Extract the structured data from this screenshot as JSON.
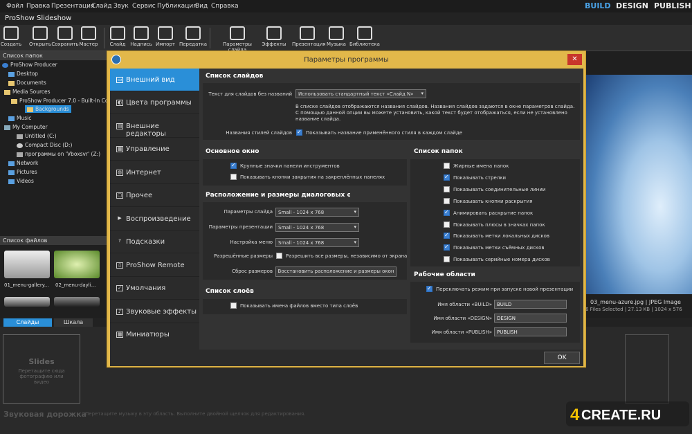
{
  "menubar": {
    "items": [
      "Файл",
      "Правка",
      "Презентация",
      "Слайд",
      "Звук",
      "Сервис",
      "Публикация",
      "Вид",
      "Справка"
    ],
    "modes": [
      "BUILD",
      "DESIGN",
      "PUBLISH"
    ]
  },
  "app": {
    "title": "ProShow Slideshow"
  },
  "toolbar": {
    "left": [
      "Создать",
      "Открыть",
      "Сохранить",
      "Мастер"
    ],
    "mid": [
      "Слайд",
      "Надпись",
      "Импорт",
      "Передатка"
    ],
    "right": [
      "Параметры слайда",
      "Эффекты",
      "Презентация",
      "Музыка",
      "Библиотека"
    ]
  },
  "folders": {
    "header": "Список папок",
    "items": [
      "ProShow Producer",
      "Desktop",
      "Documents",
      "Media Sources",
      "ProShow Producer 7.0 - Built-In Co",
      "Backgrounds",
      "Music",
      "My Computer",
      "Untitled (C:)",
      "Compact Disc (D:)",
      "программы on 'Vboxsvr' (Z:)",
      "Network",
      "Pictures",
      "Videos"
    ]
  },
  "files": {
    "header": "Список файлов",
    "thumbs": [
      "01_menu-gallery...",
      "02_menu-dayli..."
    ]
  },
  "preview": {
    "filename": "03_menu-azure.jpg",
    "type": "JPEG Image",
    "sel": "6 Files Selected",
    "size": "27.13 KB",
    "dims": "1024 x 576"
  },
  "timeline": {
    "tab_slides": "Слайды",
    "tab_scale": "Шкала",
    "slides_title": "Slides",
    "slides_hint": "Перетащите сюда фотографию или видео",
    "audio_label": "Звуковая дорожка",
    "audio_hint": "Перетащите музыку в эту область. Выполните двойной щелчок для редактирования."
  },
  "dialog": {
    "title": "Параметры программы",
    "close": "✕",
    "ok": "OK",
    "nav": [
      {
        "label": "Внешний вид",
        "icon": "▭"
      },
      {
        "label": "Цвета программы",
        "icon": "◐"
      },
      {
        "label": "Внешние редакторы",
        "icon": "▤"
      },
      {
        "label": "Управление",
        "icon": "▦"
      },
      {
        "label": "Интернет",
        "icon": "◍"
      },
      {
        "label": "Прочее",
        "icon": "▢"
      },
      {
        "label": "Воспроизведение",
        "icon": "▶"
      },
      {
        "label": "Подсказки",
        "icon": "?"
      },
      {
        "label": "ProShow Remote",
        "icon": "▯"
      },
      {
        "label": "Умолчания",
        "icon": "✓"
      },
      {
        "label": "Звуковые эффекты",
        "icon": "♪"
      },
      {
        "label": "Миниатюры",
        "icon": "▩"
      }
    ],
    "slides_list": {
      "title": "Список слайдов",
      "unnamed_label": "Текст для слайдов без названий",
      "unnamed_value": "Использовать стандартный текст «Слайд N»",
      "desc": "В списке слайдов отображаются названия слайдов. Названия слайдов задаются в окне параметров слайда. С помощью данной опции вы можете установить, какой текст будет отображаться, если не установлено название слайда.",
      "style_label": "Названия стилей слайдов",
      "style_check": "Показывать название применённого стиля в каждом слайде"
    },
    "main_window": {
      "title": "Основное окно",
      "opts": [
        "Крупные значки панели инструментов",
        "Показывать кнопки закрытия на закреплённых панелях"
      ]
    },
    "dialog_sizes": {
      "title": "Расположение и размеры диалоговых окон",
      "rows": [
        {
          "label": "Параметры слайда",
          "value": "Small - 1024 x 768"
        },
        {
          "label": "Параметры презентации",
          "value": "Small - 1024 x 768"
        },
        {
          "label": "Настройка меню",
          "value": "Small - 1024 x 768"
        }
      ],
      "allowed_label": "Разрешённые размеры",
      "allowed_check": "Разрешить все размеры, независимо от экрана",
      "reset_label": "Сброс размеров",
      "reset_btn": "Восстановить расположение и размеры окон"
    },
    "layers": {
      "title": "Список слоёв",
      "opt": "Показывать имена файлов вместо типа слоёв"
    },
    "folders_list": {
      "title": "Список папок",
      "opts": [
        {
          "t": "Жирные имена папок",
          "c": false
        },
        {
          "t": "Показывать стрелки",
          "c": true
        },
        {
          "t": "Показывать соединительные линии",
          "c": false
        },
        {
          "t": "Показывать кнопки раскрытия",
          "c": false
        },
        {
          "t": "Анимировать раскрытие папок",
          "c": true
        },
        {
          "t": "Показывать плюсы в значках папок",
          "c": false
        },
        {
          "t": "Показывать метки локальных дисков",
          "c": true
        },
        {
          "t": "Показывать метки съёмных дисков",
          "c": true
        },
        {
          "t": "Показывать серийные номера дисков",
          "c": false
        }
      ]
    },
    "workspaces": {
      "title": "Рабочие области",
      "switch": "Переключать режим при запуске новой презентации",
      "rows": [
        {
          "label": "Имя области «BUILD»",
          "value": "BUILD"
        },
        {
          "label": "Имя области «DESIGN»",
          "value": "DESIGN"
        },
        {
          "label": "Имя области «PUBLISH»",
          "value": "PUBLISH"
        }
      ]
    }
  },
  "watermark": {
    "text": "4CREATE.RU"
  },
  "colors": {
    "accent": "#2a8fd8",
    "dialog_border": "#e2b84a",
    "close": "#c8362b"
  }
}
